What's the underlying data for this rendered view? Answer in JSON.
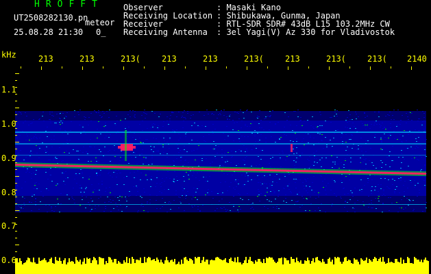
{
  "header": {
    "app_name": "HROFFT",
    "file_name": "UT2508282130.pn",
    "mode": "meteor",
    "date_time": "25.08.28 21:30",
    "count": "0_"
  },
  "info": [
    {
      "label": "Observer",
      "value": ": Masaki Kano"
    },
    {
      "label": "Receiving Location",
      "value": ": Shibukawa, Gunma, Japan"
    },
    {
      "label": "Receiver",
      "value": ": RTL-SDR SDR# 43dB L15 103.2MHz CW"
    },
    {
      "label": "Receiving Antenna",
      "value": ": 3el Yagi(V) Az 330 for Vladivostok"
    }
  ],
  "axes": {
    "y_unit": "kHz",
    "y_ticks": [
      "1.1",
      "1.0",
      "0.9",
      "0.8",
      "0.7",
      "0.6"
    ],
    "x_ticks": [
      "213",
      "213",
      "213(",
      "213",
      "213",
      "213(",
      "213",
      "213(",
      "213(",
      "2140"
    ]
  },
  "colors": {
    "noise_low": "#0000c8",
    "noise_mid": "#00c8ff",
    "signal": "#00ff00",
    "peak": "#ff1e64",
    "power_bar": "#ffff00"
  }
}
